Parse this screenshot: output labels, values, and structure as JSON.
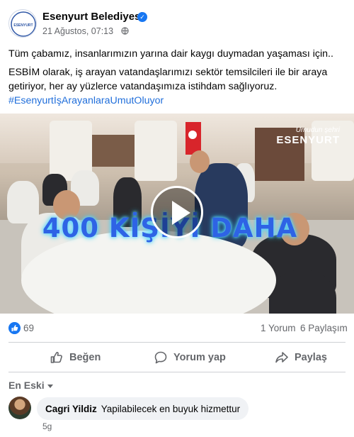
{
  "post": {
    "page_name": "Esenyurt Belediyesi",
    "timestamp": "21 Ağustos, 07:13",
    "privacy_icon": "globe-icon",
    "avatar_text": "ESENYURT",
    "text_line1": "Tüm çabamız, insanlarımızın yarına dair kaygı duymadan yaşaması için..",
    "text_line2": "ESBİM olarak, iş arayan vatandaşlarımızı sektör temsilcileri ile bir araya getiriyor, her ay yüzlerce vatandaşımıza istihdam sağlıyoruz.",
    "hashtag": "#EsenyurtİşArayanlaraUmutOluyor"
  },
  "video": {
    "overlay_text": "400 KİŞİYİ DAHA",
    "watermark_small": "Umudun şehri",
    "watermark_big": "ESENYURT",
    "play_icon": "play-icon"
  },
  "stats": {
    "likes": "69",
    "comments": "1 Yorum",
    "shares": "6 Paylaşım"
  },
  "actions": {
    "like": "Beğen",
    "comment": "Yorum yap",
    "share": "Paylaş"
  },
  "comments_section": {
    "sort_label": "En Eski",
    "items": [
      {
        "author": "Cagri Yildiz",
        "text": "Yapilabilecek en buyuk hizmettur",
        "time": "5g"
      }
    ]
  },
  "colors": {
    "brand_blue": "#1877f2",
    "hashtag": "#216fdb",
    "muted": "#65676b"
  }
}
